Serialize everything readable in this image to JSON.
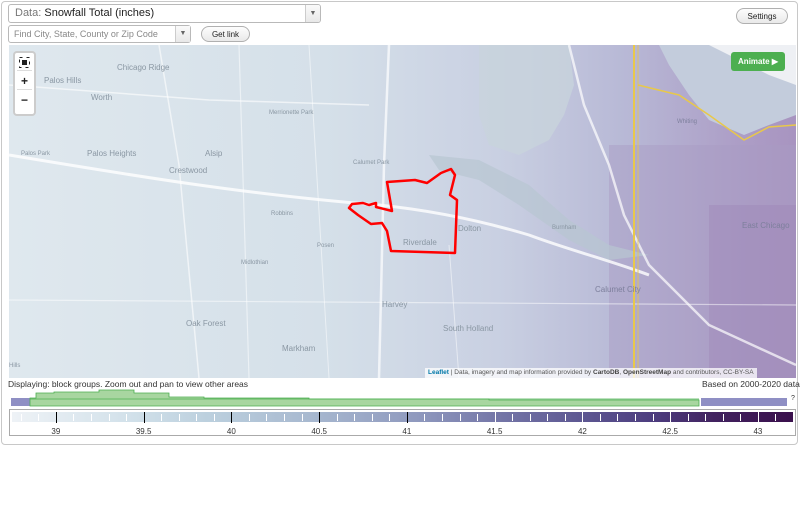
{
  "controls": {
    "data_prefix": "Data:",
    "data_value": "Snowfall Total (inches)",
    "search_placeholder": "Find City, State, County or Zip Code",
    "get_link": "Get link",
    "settings": "Settings"
  },
  "map": {
    "animate": "Animate ▶",
    "zoom_fit_icon": "fullscreen-icon",
    "zoom_in": "+",
    "zoom_out": "−",
    "places": {
      "chicago_ridge": "Chicago Ridge",
      "palos_hills": "Palos Hills",
      "worth": "Worth",
      "merrionette_park": "Merrionette Park",
      "palos_park": "Palos Park",
      "palos_heights": "Palos Heights",
      "alsip": "Alsip",
      "crestwood": "Crestwood",
      "calumet_park": "Calumet Park",
      "robbins": "Robbins",
      "posen": "Posen",
      "midlothian": "Midlothian",
      "riverdale": "Riverdale",
      "dolton": "Dolton",
      "burnham": "Burnham",
      "whiting": "Whiting",
      "east_chicago": "East Chicago",
      "harvey": "Harvey",
      "south_holland": "South Holland",
      "calumet_city": "Calumet City",
      "oak_forest": "Oak Forest",
      "markham": "Markham",
      "hills": "Hills"
    },
    "attribution": {
      "leaflet": "Leaflet",
      "text1": " | Data, imagery and map information provided by ",
      "carto": "CartoDB",
      "sep": ", ",
      "osm": "OpenStreetMap",
      "text2": " and contributors, ",
      "license": "CC-BY-SA"
    }
  },
  "notes": {
    "displaying": "Displaying: block groups. Zoom out and pan to view other areas",
    "based_on": "Based on 2000-2020 data"
  },
  "legend": {
    "min": 38.75,
    "max": 43.2,
    "labels": [
      "39",
      "39.5",
      "40",
      "40.5",
      "41",
      "41.5",
      "42",
      "42.5",
      "43"
    ]
  }
}
